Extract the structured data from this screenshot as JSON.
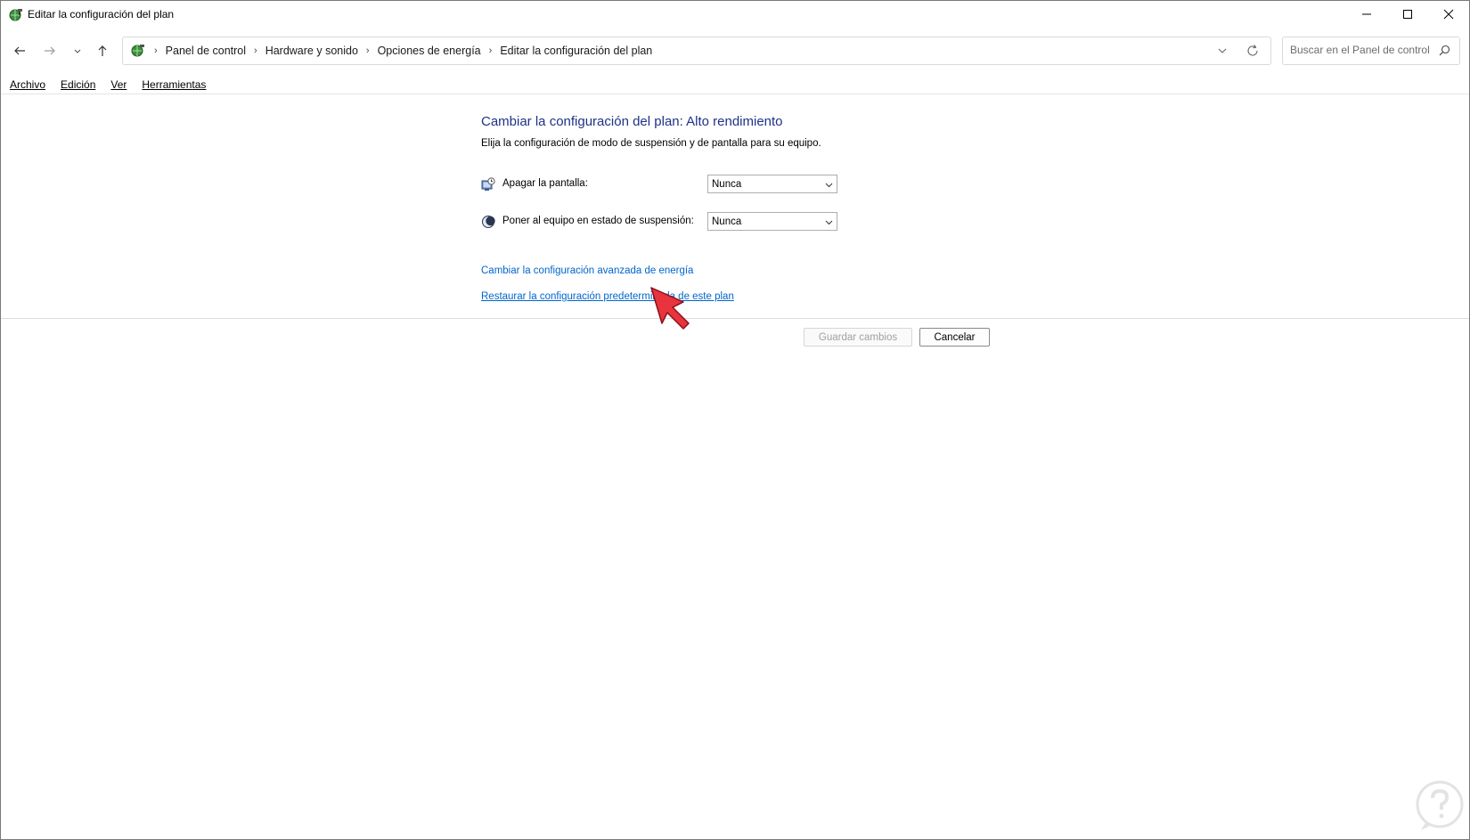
{
  "window": {
    "title": "Editar la configuración del plan"
  },
  "address": {
    "breadcrumbs": [
      "Panel de control",
      "Hardware y sonido",
      "Opciones de energía",
      "Editar la configuración del plan"
    ]
  },
  "search": {
    "placeholder": "Buscar en el Panel de control"
  },
  "menu": {
    "items": [
      "Archivo",
      "Edición",
      "Ver",
      "Herramientas"
    ]
  },
  "plan": {
    "title": "Cambiar la configuración del plan: Alto rendimiento",
    "subtitle": "Elija la configuración de modo de suspensión y de pantalla para su equipo.",
    "settings": [
      {
        "label": "Apagar la pantalla:",
        "value": "Nunca",
        "icon": "monitor-clock-icon"
      },
      {
        "label": "Poner al equipo en estado de suspensión:",
        "value": "Nunca",
        "icon": "moon-icon"
      }
    ],
    "links": {
      "advanced": "Cambiar la configuración avanzada de energía",
      "restore": "Restaurar la configuración predeterminada de este plan"
    }
  },
  "buttons": {
    "save": "Guardar cambios",
    "cancel": "Cancelar"
  },
  "colors": {
    "title_blue": "#1e3287",
    "link_blue": "#0066cc",
    "cursor_red": "#e8343f"
  }
}
